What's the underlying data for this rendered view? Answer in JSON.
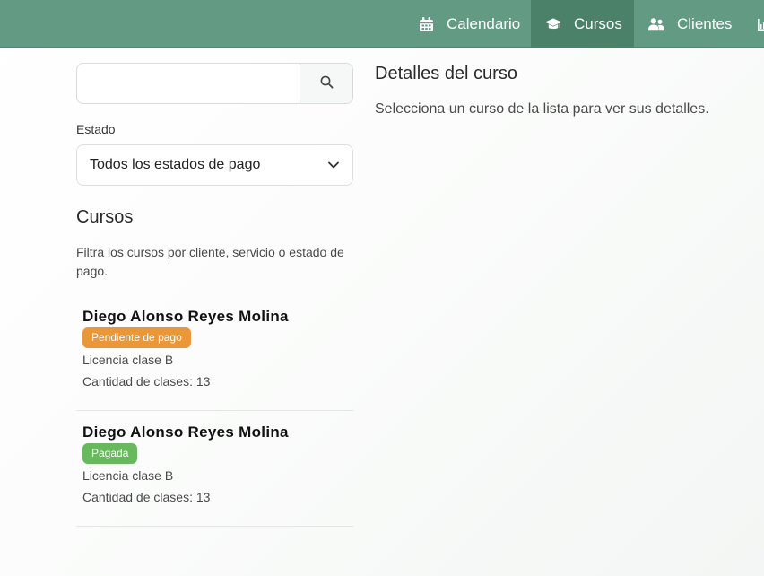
{
  "navbar": {
    "items": [
      {
        "label": "Calendario",
        "icon": "calendar-icon",
        "active": false
      },
      {
        "label": "Cursos",
        "icon": "graduation-cap-icon",
        "active": true
      },
      {
        "label": "Clientes",
        "icon": "users-icon",
        "active": false
      }
    ],
    "colors": {
      "background": "#629a83",
      "active_background": "#4b8069",
      "text": "#ffffff"
    }
  },
  "search": {
    "value": "",
    "placeholder": "",
    "button_icon": "search-icon"
  },
  "estado": {
    "label": "Estado",
    "selected": "Todos los estados de pago",
    "icon": "chevron-down-icon"
  },
  "cursos": {
    "heading": "Cursos",
    "description": "Filtra los cursos por cliente, servicio o estado de pago.",
    "items": [
      {
        "name": "Diego Alonso Reyes Molina",
        "status": "Pendiente de pago",
        "status_color": "#ea973a",
        "service": "Licencia clase B",
        "classes": "Cantidad de clases: 13"
      },
      {
        "name": "Diego Alonso Reyes Molina",
        "status": "Pagada",
        "status_color": "#68b85e",
        "service": "Licencia clase B",
        "classes": "Cantidad de clases: 13"
      }
    ]
  },
  "detalle": {
    "title": "Detalles del curso",
    "message": "Selecciona un curso de la lista para ver sus detalles."
  }
}
